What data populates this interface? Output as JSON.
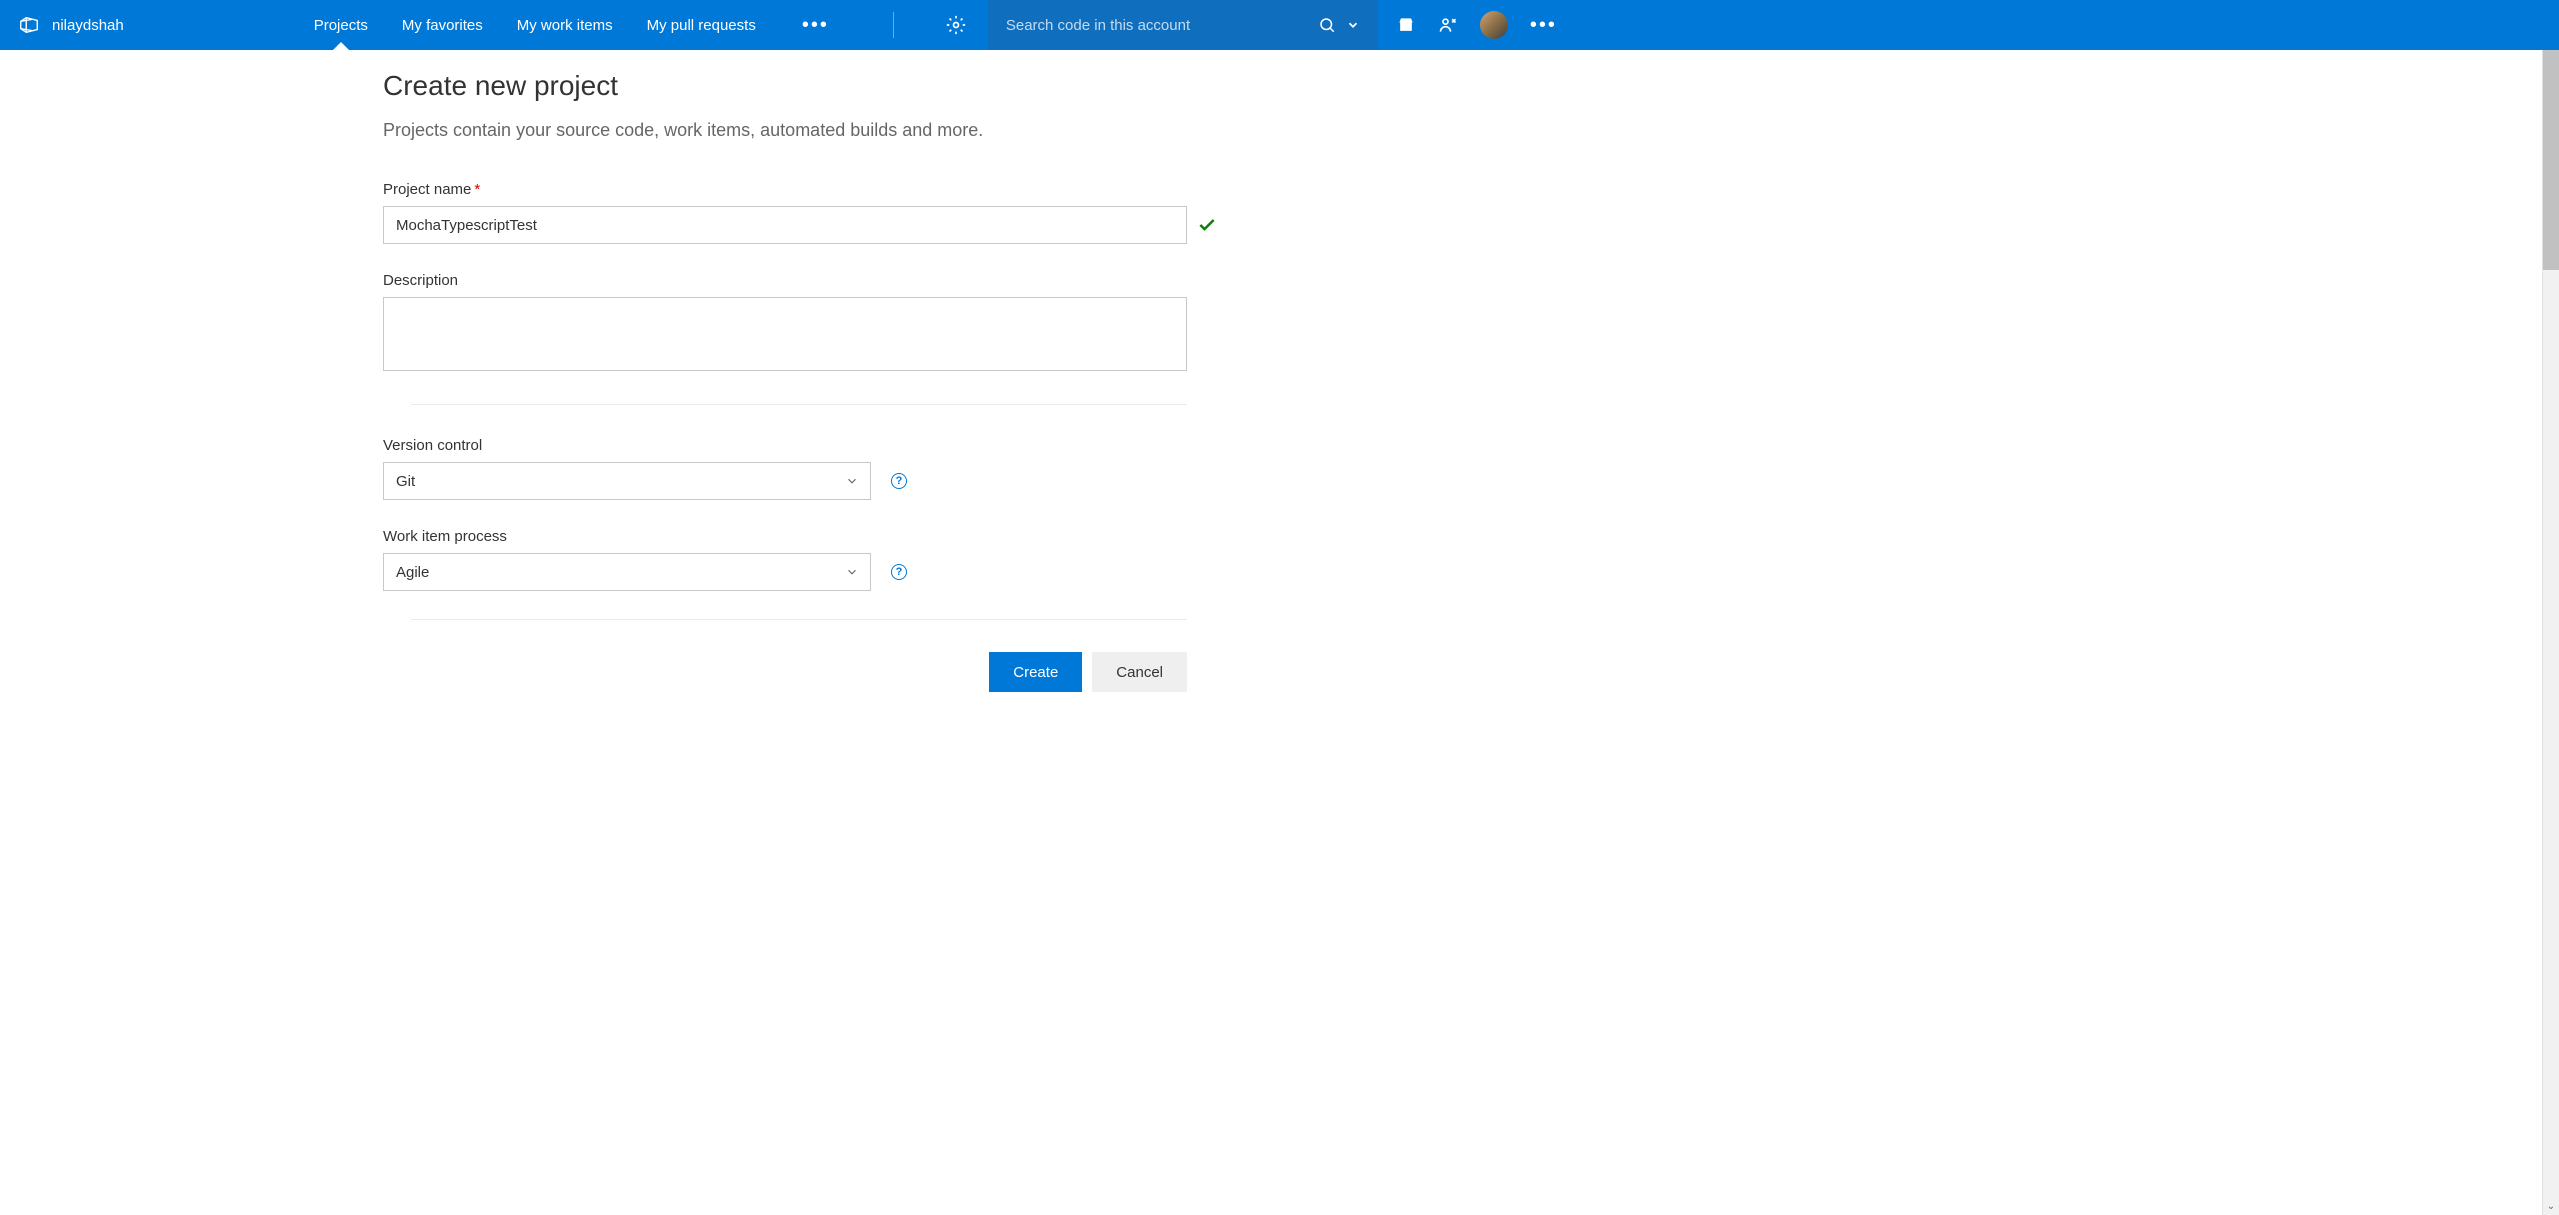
{
  "header": {
    "account_name": "nilaydshah",
    "nav": {
      "projects": "Projects",
      "favorites": "My favorites",
      "work_items": "My work items",
      "pull_requests": "My pull requests"
    },
    "search_placeholder": "Search code in this account"
  },
  "page": {
    "title": "Create new project",
    "subtitle": "Projects contain your source code, work items, automated builds and more."
  },
  "form": {
    "project_name_label": "Project name",
    "project_name_value": "MochaTypescriptTest",
    "description_label": "Description",
    "description_value": "",
    "version_control_label": "Version control",
    "version_control_value": "Git",
    "work_item_process_label": "Work item process",
    "work_item_process_value": "Agile"
  },
  "buttons": {
    "create": "Create",
    "cancel": "Cancel"
  }
}
